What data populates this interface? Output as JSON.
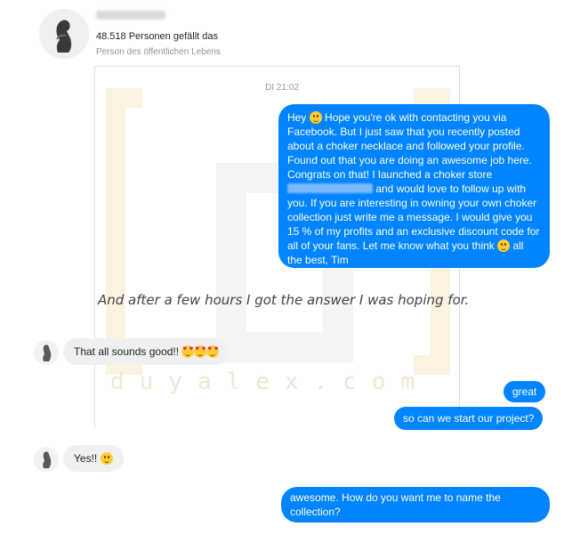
{
  "header": {
    "likes_text": "48.518 Personen gefällt das",
    "category_text": "Person des öffentlichen Lebens"
  },
  "conversation": {
    "timestamp": "DI 21:02",
    "messages": [
      {
        "direction": "outgoing",
        "parts": [
          "Hey ",
          " Hope you're ok with contacting you via Facebook. But I just saw that you recently posted about a choker necklace and followed your profile. Found out that you are doing an awesome job here. Congrats on that! I launched a choker store ",
          " and would love to follow up with you. If you are interesting in owning your own choker collection just write me a message. I would give you 15 % of my profits and an exclusive discount code for all of your fans. Let me know what you think ",
          " all the best, Tim"
        ]
      },
      {
        "direction": "incoming",
        "text": "That all sounds good!! "
      },
      {
        "direction": "outgoing",
        "text": "great"
      },
      {
        "direction": "outgoing",
        "text": "so can we start our project?"
      },
      {
        "direction": "incoming",
        "text": "Yes!! "
      },
      {
        "direction": "outgoing",
        "text": "awesome. How do you want me to name the collection?"
      }
    ]
  },
  "caption": "And after a few hours I got the answer I was hoping for.",
  "watermark": "duyalex.com",
  "colors": {
    "outgoing_bubble": "#0084ff",
    "incoming_bubble": "#f1f0f0",
    "watermark": "#f7e7c0"
  },
  "icons": [
    "avatar",
    "smiley-emoji",
    "heart-eyes-emoji"
  ]
}
